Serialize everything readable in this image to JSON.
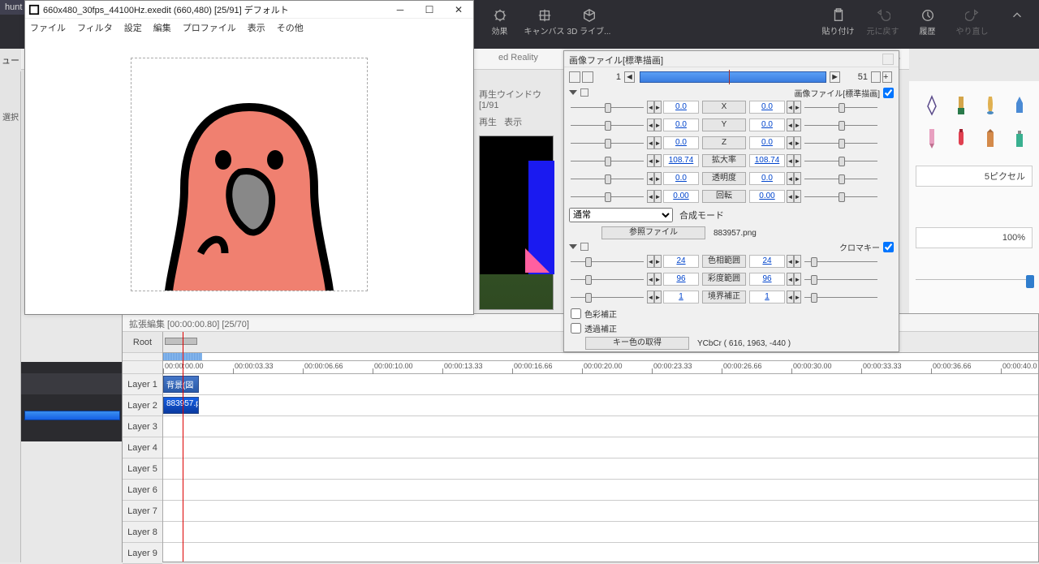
{
  "bg": {
    "tools": [
      "効果",
      "キャンバス",
      "3D ライブ..."
    ],
    "rtools": [
      "貼り付け",
      "元に戻す",
      "履歴",
      "やり直し"
    ],
    "panel_hint": "ed Reality"
  },
  "hunt": "hunt",
  "left": {
    "l1": "ュー",
    "l2": "選択"
  },
  "aviutl": {
    "title": "660x480_30fps_44100Hz.exedit (660,480) [25/91] デフォルト",
    "menu": [
      "ファイル",
      "フィルタ",
      "設定",
      "編集",
      "プロファイル",
      "表示",
      "その他"
    ]
  },
  "playwin": {
    "title": "再生ウインドウ  [1/91",
    "menu": [
      "再生",
      "表示"
    ]
  },
  "right": {
    "size": "5ピクセル",
    "pct": "100%"
  },
  "timeline": {
    "head": "拡張編集 [00:00:00.80] [25/70]",
    "root": "Root",
    "layers": [
      "Layer 1",
      "Layer 2",
      "Layer 3",
      "Layer 4",
      "Layer 5",
      "Layer 6",
      "Layer 7",
      "Layer 8",
      "Layer 9"
    ],
    "ticks": [
      "00:00:00.00",
      "00:00:03.33",
      "00:00:06.66",
      "00:00:10.00",
      "00:00:13.33",
      "00:00:16.66",
      "00:00:20.00",
      "00:00:23.33",
      "00:00:26.66",
      "00:00:30.00",
      "00:00:33.33",
      "00:00:36.66",
      "00:00:40.0"
    ],
    "clips": {
      "l1": "背景(図形",
      "l2": "883957.p"
    }
  },
  "props": {
    "title": "画像ファイル[標準描画]",
    "frame_start": "1",
    "frame_end": "51",
    "section": "画像ファイル[標準描画]",
    "rows": [
      {
        "l": "0.0",
        "n": "X",
        "r": "0.0"
      },
      {
        "l": "0.0",
        "n": "Y",
        "r": "0.0"
      },
      {
        "l": "0.0",
        "n": "Z",
        "r": "0.0"
      },
      {
        "l": "108.74",
        "n": "拡大率",
        "r": "108.74"
      },
      {
        "l": "0.0",
        "n": "透明度",
        "r": "0.0"
      },
      {
        "l": "0.00",
        "n": "回転",
        "r": "0.00"
      }
    ],
    "mode": "通常",
    "mode_label": "合成モード",
    "file_btn": "参照ファイル",
    "file_name": "883957.png",
    "chroma": "クロマキー",
    "crows": [
      {
        "l": "24",
        "n": "色相範囲",
        "r": "24"
      },
      {
        "l": "96",
        "n": "彩度範囲",
        "r": "96"
      },
      {
        "l": "1",
        "n": "境界補正",
        "r": "1"
      }
    ],
    "chk1": "色彩補正",
    "chk2": "透過補正",
    "key_btn": "キー色の取得",
    "key_val": "YCbCr ( 616, 1963, -440 )"
  }
}
